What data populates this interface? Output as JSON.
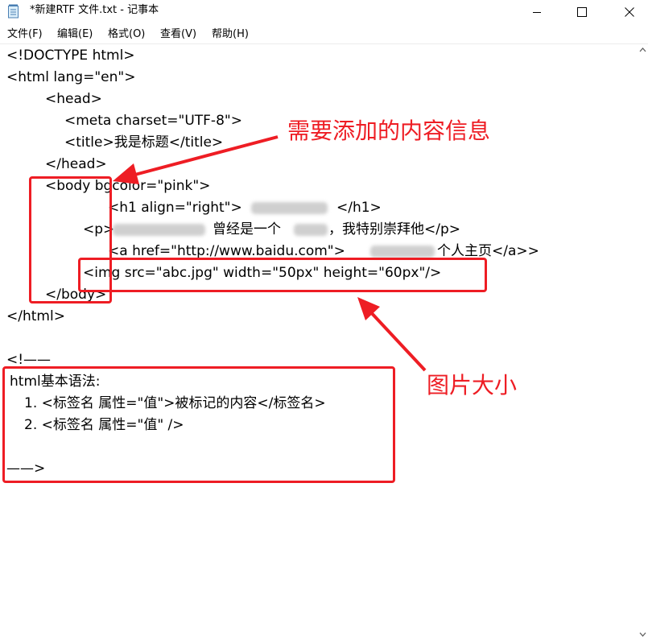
{
  "window": {
    "title": "*新建RTF 文件.txt - 记事本",
    "icon": "notepad-icon",
    "controls": [
      "minimize-icon",
      "maximize-icon",
      "close-icon"
    ]
  },
  "menu": [
    {
      "label": "文件(F)"
    },
    {
      "label": "编辑(E)"
    },
    {
      "label": "格式(O)"
    },
    {
      "label": "查看(V)"
    },
    {
      "label": "帮助(H)"
    }
  ],
  "document": {
    "lines": [
      "<!DOCTYPE html>",
      "<html lang=\"en\">",
      "<head>",
      "<meta charset=\"UTF-8\">",
      "<title>我是标题</title>",
      "</head>",
      "<body bgcolor=\"pink\">",
      "<h1 align=\"right\">",
      "</h1>",
      "<p>",
      "曾经是一个",
      "，我特别崇拜他</p>",
      "<a href=\"http://www.baidu.com\">",
      "个人主页</a>>",
      "<img src=\"abc.jpg\" width=\"50px\" height=\"60px\"/>",
      "</body>",
      "</html>",
      "<!——",
      "html基本语法:",
      "1. <标签名 属性=\"值\">被标记的内容</标签名>",
      "2. <标签名 属性=\"值\" />",
      "——>"
    ]
  },
  "annotations": {
    "label_top": "需要添加的内容信息",
    "label_bottom": "图片大小",
    "color": "#ee1d24"
  }
}
